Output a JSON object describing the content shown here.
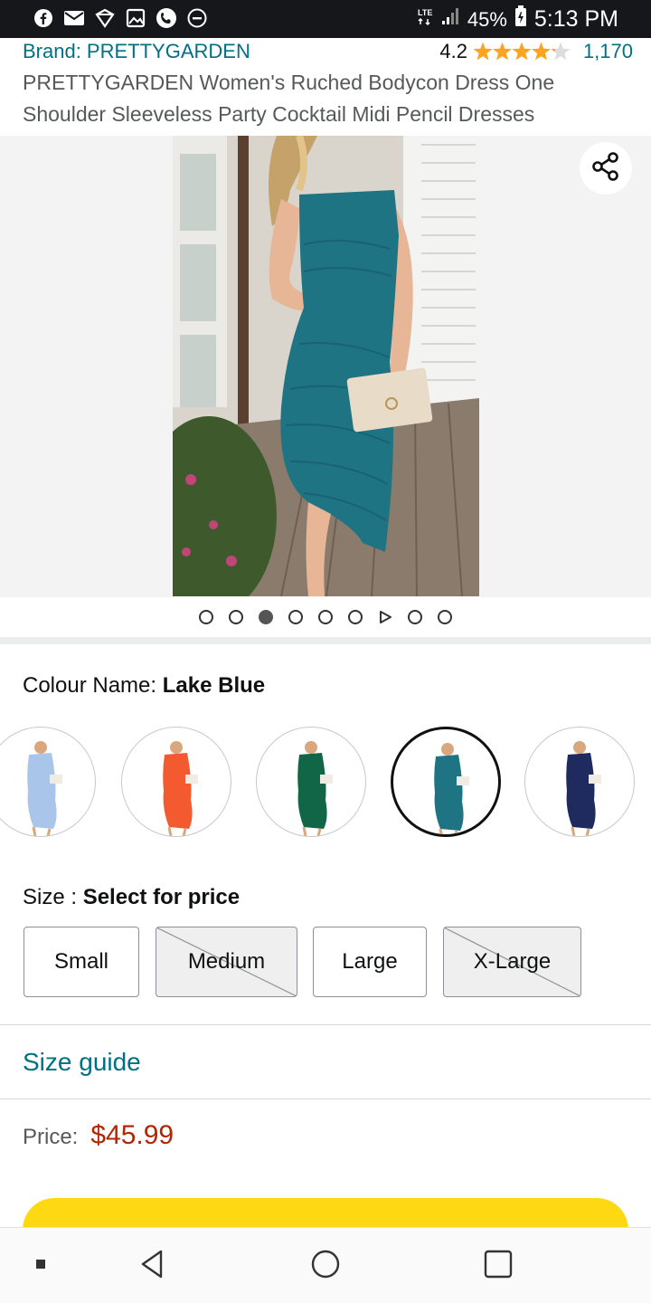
{
  "status_bar": {
    "battery_percent": "45%",
    "time": "5:13 PM",
    "network": "LTE",
    "icons": [
      "facebook-icon",
      "mail-icon",
      "app-icon",
      "gallery-icon",
      "phone-icon",
      "dnd-icon"
    ]
  },
  "product": {
    "brand": "Brand: PRETTYGARDEN",
    "rating_value": "4.2",
    "rating_fraction": 0.84,
    "rating_count": "1,170",
    "title": "PRETTYGARDEN Women's Ruched Bodycon Dress One Shoulder Sleeveless Party Cocktail Midi Pencil Dresses",
    "dress_color": "#1f7484"
  },
  "gallery": {
    "image_count": 9,
    "active_index": 2,
    "video_index": 6
  },
  "colour": {
    "label": "Colour Name: ",
    "selected": "Lake Blue",
    "swatches": [
      {
        "color": "#a9c6ea"
      },
      {
        "color": "#f45a30"
      },
      {
        "color": "#116648"
      },
      {
        "color": "#1f7484",
        "selected": true
      },
      {
        "color": "#1f2b5e"
      }
    ]
  },
  "size": {
    "label": "Size : ",
    "prompt": "Select for price",
    "options": [
      {
        "label": "Small",
        "available": true
      },
      {
        "label": "Medium",
        "available": false
      },
      {
        "label": "Large",
        "available": true
      },
      {
        "label": "X-Large",
        "available": false
      }
    ]
  },
  "size_guide": "Size guide",
  "price": {
    "label": "Price:",
    "value": "$45.99"
  },
  "colors": {
    "link": "#007185",
    "price": "#b12704",
    "cart_button": "#ffd814",
    "star": "#ffa41c"
  }
}
